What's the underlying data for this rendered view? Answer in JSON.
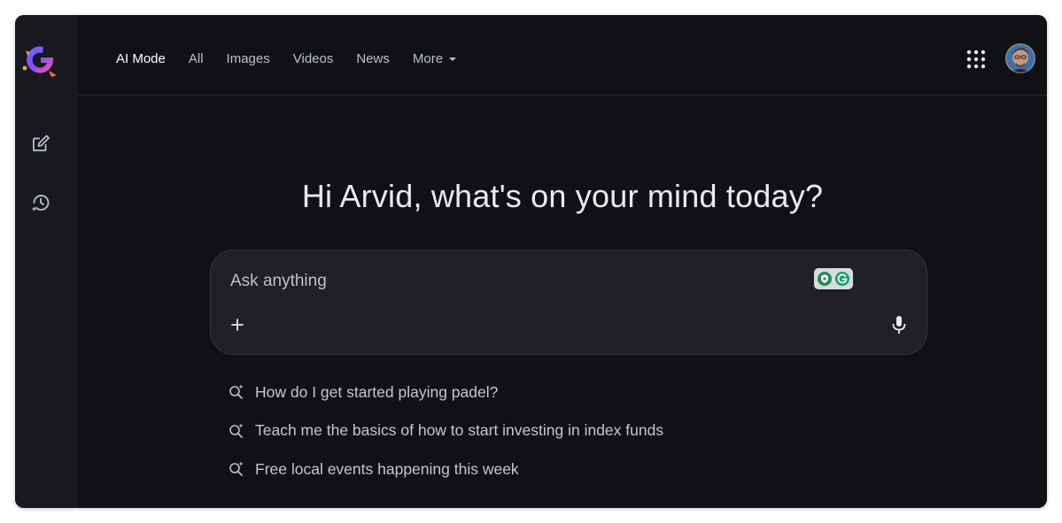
{
  "nav": {
    "items": [
      {
        "label": "AI Mode",
        "active": true
      },
      {
        "label": "All"
      },
      {
        "label": "Images"
      },
      {
        "label": "Videos"
      },
      {
        "label": "News"
      },
      {
        "label": "More",
        "dropdown": true
      }
    ]
  },
  "sidebar": {
    "buttons": [
      {
        "icon": "new-chat-icon"
      },
      {
        "icon": "history-icon"
      }
    ]
  },
  "main": {
    "greeting": "Hi Arvid, what's on your mind today?"
  },
  "search": {
    "placeholder": "Ask anything",
    "value": ""
  },
  "suggestions": [
    "How do I get started playing padel?",
    "Teach me the basics of how to start investing in index funds",
    "Free local events happening this week"
  ],
  "colors": {
    "background": "#0f1115",
    "sidebar": "#17191e",
    "search_box": "#1f2025",
    "text_primary": "#e8eaed",
    "text_secondary": "#bdc1c6"
  }
}
